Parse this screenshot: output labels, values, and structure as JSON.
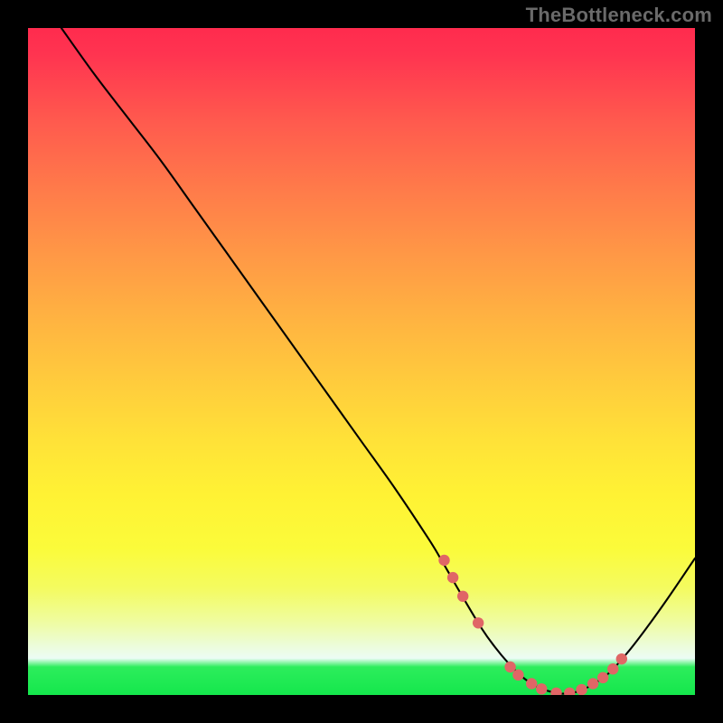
{
  "watermark": "TheBottleneck.com",
  "colors": {
    "page_bg": "#000000",
    "gradient_top": "#ff2b4e",
    "gradient_mid": "#ffe238",
    "gradient_bottom": "#14e74c",
    "curve": "#000000",
    "dots": "#e06666",
    "watermark": "#6a6a6a"
  },
  "chart_data": {
    "type": "line",
    "title": "",
    "xlabel": "",
    "ylabel": "",
    "xlim": [
      0,
      100
    ],
    "ylim": [
      0,
      100
    ],
    "grid": false,
    "x": [
      5,
      10,
      15,
      20,
      25,
      30,
      35,
      40,
      45,
      50,
      55,
      60,
      62,
      65,
      68,
      70,
      72,
      74,
      76,
      78,
      80,
      82,
      84,
      87,
      90,
      93,
      96,
      100
    ],
    "bottleneck_y": [
      100,
      93,
      86.5,
      80,
      73,
      66,
      59,
      52,
      45,
      38,
      31,
      23.5,
      20.2,
      15,
      10,
      7.2,
      4.8,
      2.8,
      1.4,
      0.6,
      0.2,
      0.4,
      1.2,
      3.2,
      6.5,
      10.4,
      14.6,
      20.5
    ],
    "optimal_zone_points": [
      {
        "x": 62.4,
        "y": 20.2
      },
      {
        "x": 63.7,
        "y": 17.6
      },
      {
        "x": 65.2,
        "y": 14.8
      },
      {
        "x": 67.5,
        "y": 10.8
      },
      {
        "x": 72.3,
        "y": 4.2
      },
      {
        "x": 73.5,
        "y": 3.0
      },
      {
        "x": 75.5,
        "y": 1.7
      },
      {
        "x": 77.0,
        "y": 0.9
      },
      {
        "x": 79.2,
        "y": 0.3
      },
      {
        "x": 81.2,
        "y": 0.3
      },
      {
        "x": 83.0,
        "y": 0.8
      },
      {
        "x": 84.7,
        "y": 1.7
      },
      {
        "x": 86.2,
        "y": 2.6
      },
      {
        "x": 87.7,
        "y": 3.9
      },
      {
        "x": 89.0,
        "y": 5.4
      }
    ]
  }
}
